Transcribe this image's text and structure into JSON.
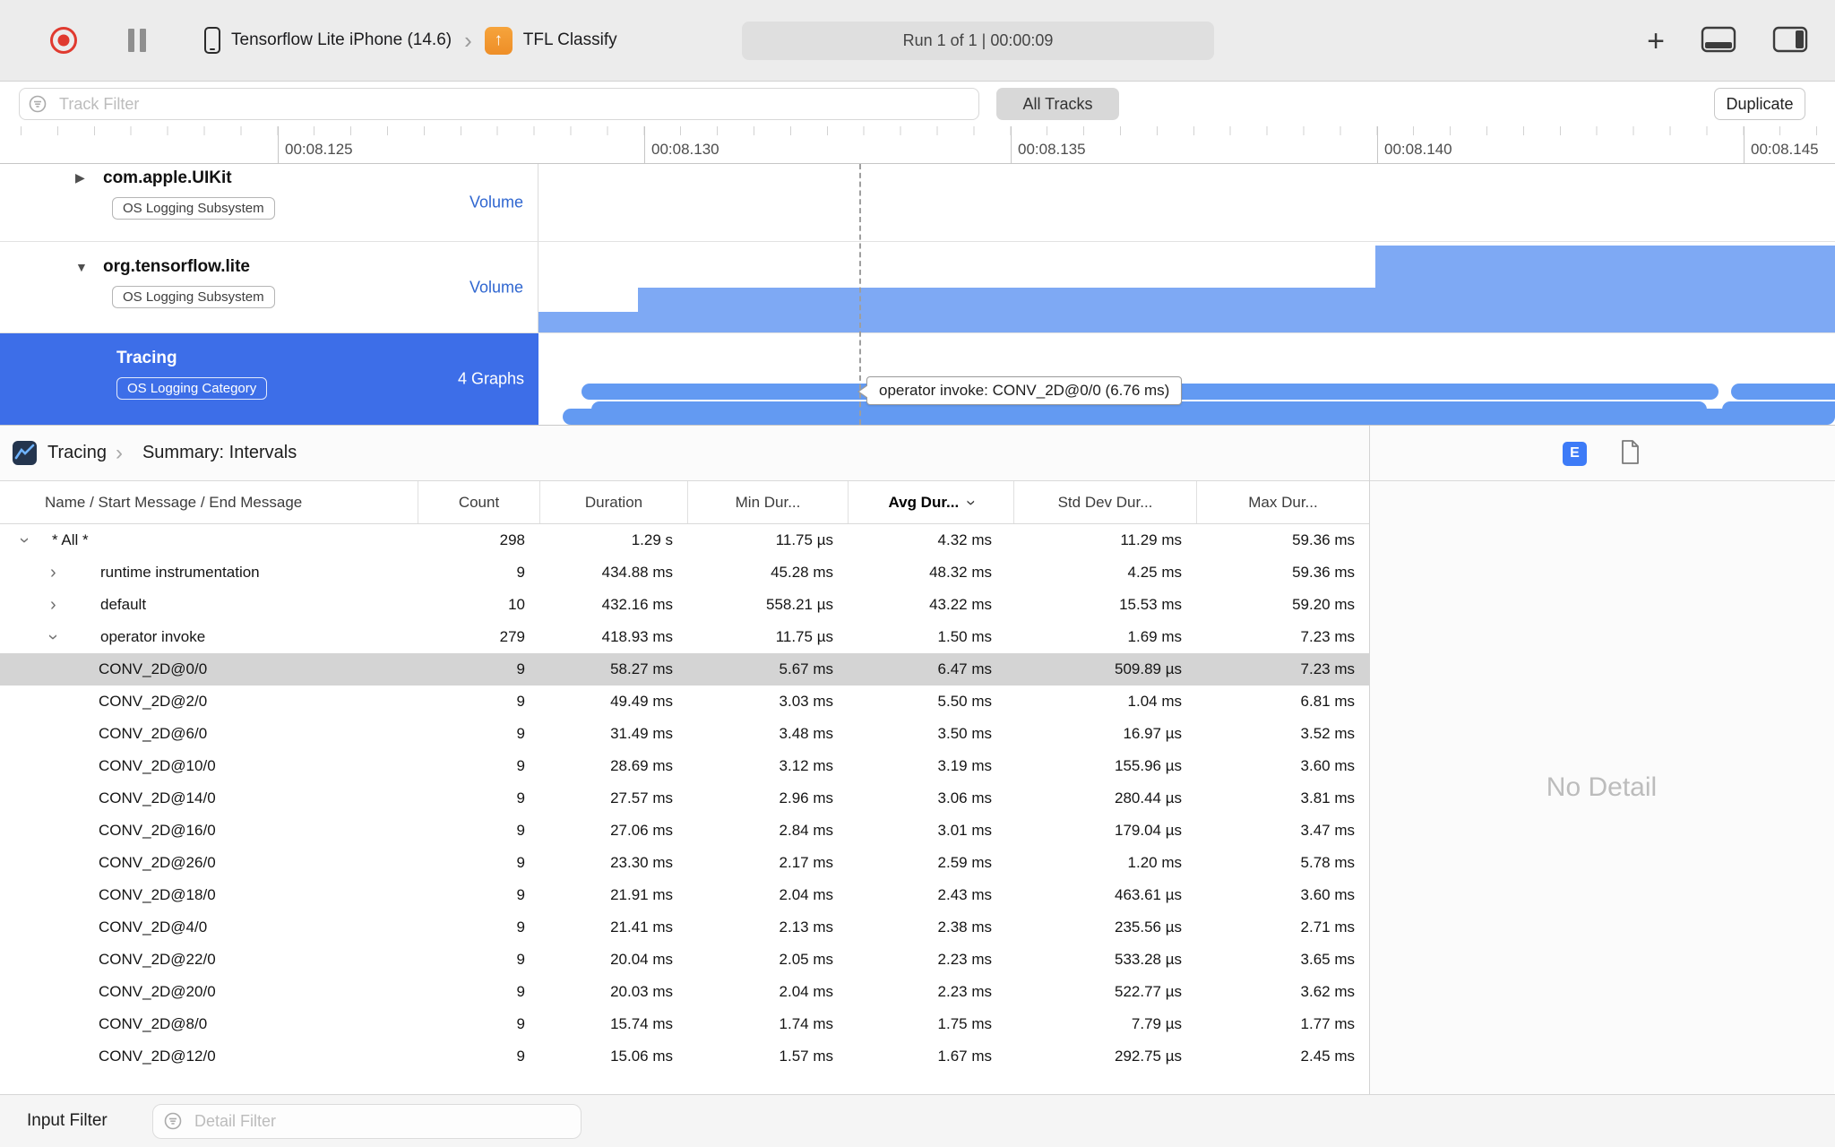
{
  "toolbar": {
    "device_name": "Tensorflow Lite iPhone (14.6)",
    "app_name": "TFL Classify",
    "run_status": "Run 1 of 1  |  00:00:09"
  },
  "filter_bar": {
    "track_filter_placeholder": "Track Filter",
    "all_tracks_label": "All Tracks",
    "duplicate_label": "Duplicate"
  },
  "ruler": {
    "labels": [
      "00:08.125",
      "00:08.130",
      "00:08.135",
      "00:08.140",
      "00:08.145"
    ]
  },
  "tracks": [
    {
      "name": "com.apple.UIKit",
      "badge": "OS Logging Subsystem",
      "side": "Volume",
      "disclosure": "closed",
      "selected": false
    },
    {
      "name": "org.tensorflow.lite",
      "badge": "OS Logging Subsystem",
      "side": "Volume",
      "disclosure": "open",
      "selected": false
    },
    {
      "name": "Tracing",
      "badge": "OS Logging Category",
      "side": "4 Graphs",
      "disclosure": "none",
      "selected": true
    }
  ],
  "timeline": {
    "tooltip": "operator invoke: CONV_2D@0/0 (6.76 ms)"
  },
  "pane": {
    "breadcrumb": {
      "instrument": "Tracing",
      "page": "Summary: Intervals"
    },
    "extended_detail_button": "E",
    "detail_placeholder": "No Detail",
    "table": {
      "columns": [
        "Name / Start Message / End Message",
        "Count",
        "Duration",
        "Min Dur...",
        "Avg Dur...",
        "Std Dev Dur...",
        "Max Dur..."
      ],
      "sorted_column": "Avg Dur...",
      "rows": [
        {
          "name": "* All *",
          "count": "298",
          "duration": "1.29 s",
          "min": "11.75 µs",
          "avg": "4.32 ms",
          "std": "11.29 ms",
          "max": "59.36 ms",
          "level": 0,
          "disclosure": "open",
          "selected": false
        },
        {
          "name": "runtime instrumentation",
          "count": "9",
          "duration": "434.88 ms",
          "min": "45.28 ms",
          "avg": "48.32 ms",
          "std": "4.25 ms",
          "max": "59.36 ms",
          "level": 1,
          "disclosure": "closed",
          "selected": false
        },
        {
          "name": "default",
          "count": "10",
          "duration": "432.16 ms",
          "min": "558.21 µs",
          "avg": "43.22 ms",
          "std": "15.53 ms",
          "max": "59.20 ms",
          "level": 1,
          "disclosure": "closed",
          "selected": false
        },
        {
          "name": "operator invoke",
          "count": "279",
          "duration": "418.93 ms",
          "min": "11.75 µs",
          "avg": "1.50 ms",
          "std": "1.69 ms",
          "max": "7.23 ms",
          "level": 1,
          "disclosure": "open",
          "selected": false
        },
        {
          "name": "CONV_2D@0/0",
          "count": "9",
          "duration": "58.27 ms",
          "min": "5.67 ms",
          "avg": "6.47 ms",
          "std": "509.89 µs",
          "max": "7.23 ms",
          "level": 2,
          "selected": true
        },
        {
          "name": "CONV_2D@2/0",
          "count": "9",
          "duration": "49.49 ms",
          "min": "3.03 ms",
          "avg": "5.50 ms",
          "std": "1.04 ms",
          "max": "6.81 ms",
          "level": 2,
          "selected": false
        },
        {
          "name": "CONV_2D@6/0",
          "count": "9",
          "duration": "31.49 ms",
          "min": "3.48 ms",
          "avg": "3.50 ms",
          "std": "16.97 µs",
          "max": "3.52 ms",
          "level": 2,
          "selected": false
        },
        {
          "name": "CONV_2D@10/0",
          "count": "9",
          "duration": "28.69 ms",
          "min": "3.12 ms",
          "avg": "3.19 ms",
          "std": "155.96 µs",
          "max": "3.60 ms",
          "level": 2,
          "selected": false
        },
        {
          "name": "CONV_2D@14/0",
          "count": "9",
          "duration": "27.57 ms",
          "min": "2.96 ms",
          "avg": "3.06 ms",
          "std": "280.44 µs",
          "max": "3.81 ms",
          "level": 2,
          "selected": false
        },
        {
          "name": "CONV_2D@16/0",
          "count": "9",
          "duration": "27.06 ms",
          "min": "2.84 ms",
          "avg": "3.01 ms",
          "std": "179.04 µs",
          "max": "3.47 ms",
          "level": 2,
          "selected": false
        },
        {
          "name": "CONV_2D@26/0",
          "count": "9",
          "duration": "23.30 ms",
          "min": "2.17 ms",
          "avg": "2.59 ms",
          "std": "1.20 ms",
          "max": "5.78 ms",
          "level": 2,
          "selected": false
        },
        {
          "name": "CONV_2D@18/0",
          "count": "9",
          "duration": "21.91 ms",
          "min": "2.04 ms",
          "avg": "2.43 ms",
          "std": "463.61 µs",
          "max": "3.60 ms",
          "level": 2,
          "selected": false
        },
        {
          "name": "CONV_2D@4/0",
          "count": "9",
          "duration": "21.41 ms",
          "min": "2.13 ms",
          "avg": "2.38 ms",
          "std": "235.56 µs",
          "max": "2.71 ms",
          "level": 2,
          "selected": false
        },
        {
          "name": "CONV_2D@22/0",
          "count": "9",
          "duration": "20.04 ms",
          "min": "2.05 ms",
          "avg": "2.23 ms",
          "std": "533.28 µs",
          "max": "3.65 ms",
          "level": 2,
          "selected": false
        },
        {
          "name": "CONV_2D@20/0",
          "count": "9",
          "duration": "20.03 ms",
          "min": "2.04 ms",
          "avg": "2.23 ms",
          "std": "522.77 µs",
          "max": "3.62 ms",
          "level": 2,
          "selected": false
        },
        {
          "name": "CONV_2D@8/0",
          "count": "9",
          "duration": "15.74 ms",
          "min": "1.74 ms",
          "avg": "1.75 ms",
          "std": "7.79 µs",
          "max": "1.77 ms",
          "level": 2,
          "selected": false
        },
        {
          "name": "CONV_2D@12/0",
          "count": "9",
          "duration": "15.06 ms",
          "min": "1.57 ms",
          "avg": "1.67 ms",
          "std": "292.75 µs",
          "max": "2.45 ms",
          "level": 2,
          "selected": false
        }
      ]
    }
  },
  "footer": {
    "input_filter_label": "Input Filter",
    "detail_filter_placeholder": "Detail Filter"
  },
  "colors": {
    "selection_blue": "#3d6ee8",
    "interval_bar_blue": "#639af2",
    "volume_bar_blue": "#7ea9f4",
    "record_red": "#e03a2f",
    "extended_detail_blue": "#3d7bf7",
    "side_label_blue": "#2f66d0"
  }
}
